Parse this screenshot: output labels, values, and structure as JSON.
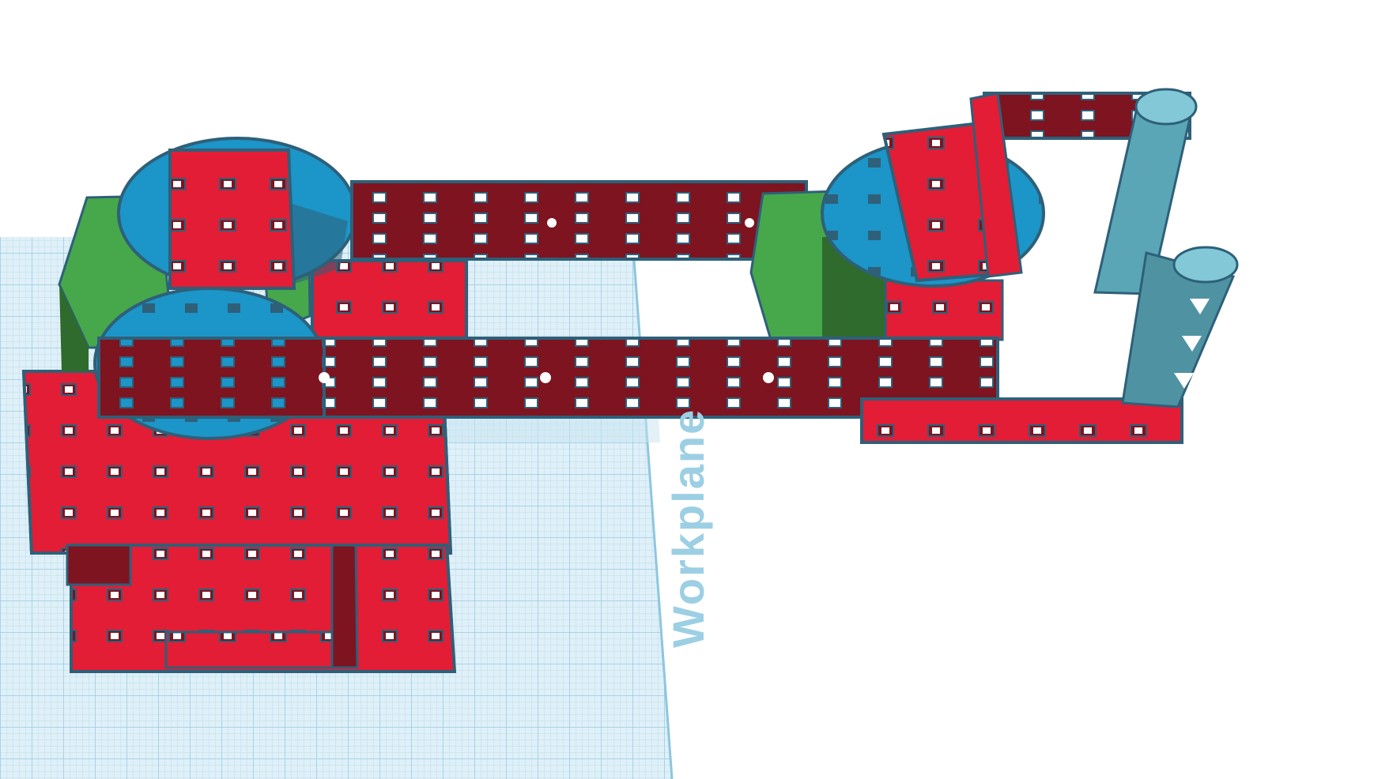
{
  "workplane": {
    "label": "Workplane"
  },
  "colors": {
    "plane": "#dff0f8",
    "grid_minor": "#b9dbeb",
    "grid_major": "#8ec6df",
    "beam_red": "#e31d35",
    "beam_dark": "#7d1420",
    "beam_outline": "#2e6079",
    "disc_blue": "#1c95c8",
    "block_green": "#46a84b",
    "block_green_dark": "#2e6b2c",
    "cylinder_teal": "#5aa6b7"
  },
  "scene": {
    "objects": [
      "workplane-grid",
      "base-plate-stack",
      "left-motor-block",
      "left-turntable-discs",
      "upper-arm-beam",
      "lower-arm-beam",
      "right-motor-block",
      "right-turntable-disc",
      "gripper-frame",
      "gripper-fingers"
    ]
  }
}
